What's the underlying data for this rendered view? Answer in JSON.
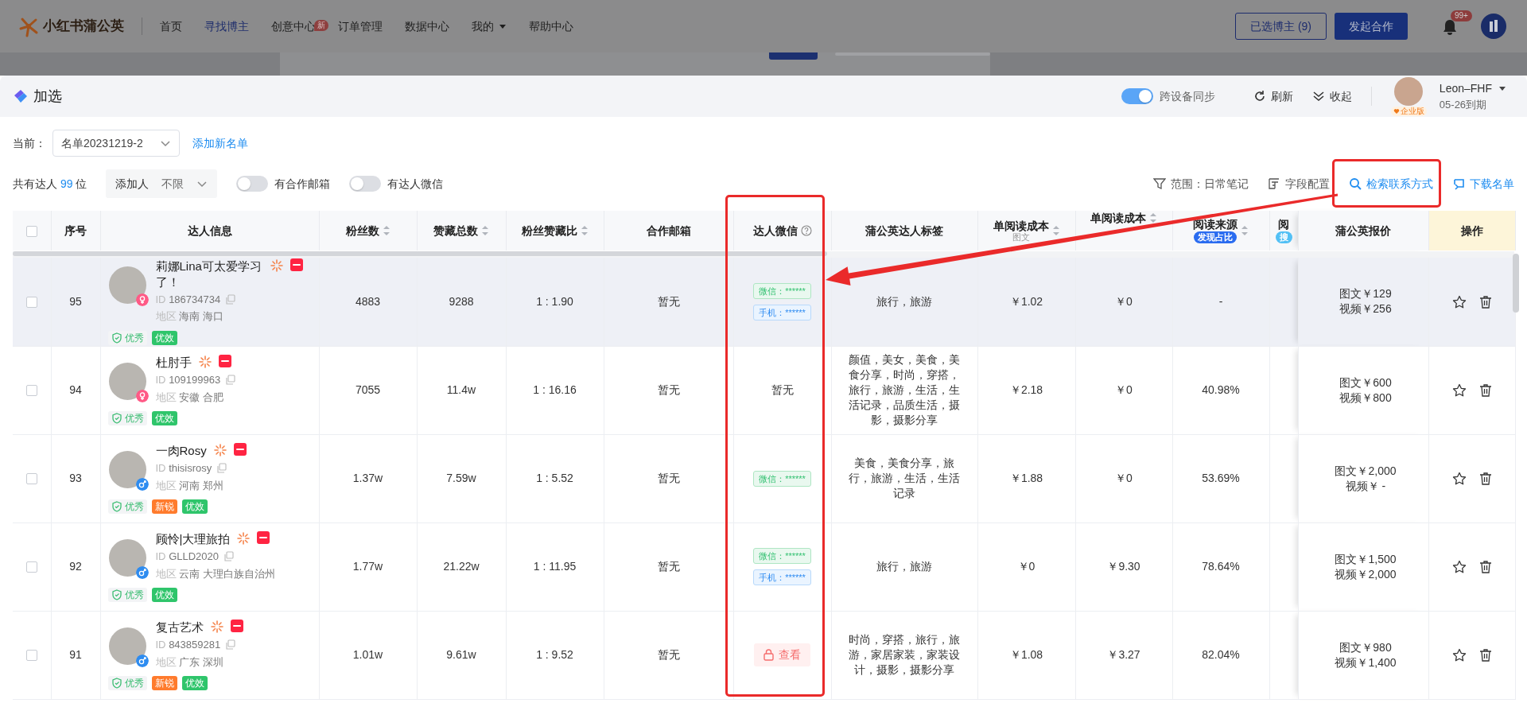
{
  "app_nav": {
    "logo": "小红书蒲公英",
    "items": [
      {
        "label": "首页",
        "selected": false
      },
      {
        "label": "寻找博主",
        "selected": true
      },
      {
        "label": "创意中心",
        "selected": false,
        "badge": "新"
      },
      {
        "label": "订单管理",
        "selected": false
      },
      {
        "label": "数据中心",
        "selected": false
      },
      {
        "label": "我的",
        "selected": false,
        "dropdown": true
      },
      {
        "label": "帮助中心",
        "selected": false
      }
    ],
    "selected_button": "已选博主 (9)",
    "primary_button": "发起合作",
    "notification_badge": "99+"
  },
  "panel": {
    "title": "加选",
    "sync": {
      "label": "跨设备同步",
      "on": true
    },
    "refresh": "刷新",
    "collapse": "收起",
    "user": {
      "name": "Leon–FHF",
      "expiry": "05-26到期",
      "badge": "企业版"
    }
  },
  "list_bar": {
    "label": "当前：",
    "selected_list": "名单20231219-2",
    "add_link": "添加新名单"
  },
  "filter_bar": {
    "total_prefix": "共有达人",
    "total_count": "99",
    "total_suffix": "位",
    "adder": {
      "label": "添加人",
      "value": "不限"
    },
    "toggles": [
      {
        "label": "有合作邮箱",
        "on": false
      },
      {
        "label": "有达人微信",
        "on": false
      }
    ],
    "actions": [
      {
        "label": "范围：日常笔记",
        "kind": "filter",
        "highlighted": false
      },
      {
        "label": "字段配置",
        "kind": "fields",
        "highlighted": false
      },
      {
        "label": "检索联系方式",
        "kind": "search",
        "highlighted": true
      },
      {
        "label": "下载名单",
        "kind": "download",
        "highlighted": true
      }
    ]
  },
  "table": {
    "columns": [
      {
        "kind": "checkbox",
        "checked": false
      },
      {
        "label": "序号"
      },
      {
        "label": "达人信息"
      },
      {
        "label": "粉丝数",
        "sortable": true
      },
      {
        "label": "赞藏总数",
        "sortable": true
      },
      {
        "label": "粉丝赞藏比",
        "sortable": true
      },
      {
        "label": "合作邮箱"
      },
      {
        "label": "达人微信",
        "help": true
      },
      {
        "label": "蒲公英达人标签"
      },
      {
        "label": "单阅读成本",
        "sub": "图文",
        "sortable": true
      },
      {
        "label": "单阅读成本",
        "sortable": true
      },
      {
        "label": "阅读来源",
        "badge": "发现占比",
        "sortable": true
      },
      {
        "label": "阅",
        "badge": "搜"
      },
      {
        "label": "蒲公英报价"
      },
      {
        "label": "操作"
      }
    ],
    "rows": [
      {
        "checked": false,
        "highlighted": true,
        "index": "95",
        "name": "莉娜Lina可太爱学习了！",
        "female": true,
        "id_label": "ID",
        "id": "186734734",
        "region_label": "地区",
        "region": "海南 海口",
        "tags": [
          {
            "label": "优秀",
            "kind": "excellent"
          },
          {
            "label": "优效",
            "kind": "effective"
          }
        ],
        "fans": "4883",
        "likes": "9288",
        "ratio": "1 : 1.90",
        "email": "暂无",
        "contact": {
          "kind": "masked",
          "items": [
            {
              "label": "微信：******",
              "kind": "wechat"
            },
            {
              "label": "手机：******",
              "kind": "phone"
            }
          ]
        },
        "topics": "旅行，旅游",
        "cost_image": "￥1.02",
        "cost_video": "￥0",
        "discover_share": "-",
        "price": [
          "图文￥129",
          "视频￥256"
        ]
      },
      {
        "checked": false,
        "highlighted": false,
        "index": "94",
        "name": "杜肘手",
        "female": true,
        "id_label": "ID",
        "id": "109199963",
        "region_label": "地区",
        "region": "安徽 合肥",
        "tags": [
          {
            "label": "优秀",
            "kind": "excellent"
          },
          {
            "label": "优效",
            "kind": "effective"
          }
        ],
        "fans": "7055",
        "likes": "11.4w",
        "ratio": "1 : 16.16",
        "email": "暂无",
        "contact": {
          "kind": "none",
          "label": "暂无"
        },
        "topics": "颜值，美女，美食，美食分享，时尚，穿搭，旅行，旅游，生活，生活记录，品质生活，摄影，摄影分享",
        "cost_image": "￥2.18",
        "cost_video": "￥0",
        "discover_share": "40.98%",
        "price": [
          "图文￥600",
          "视频￥800"
        ]
      },
      {
        "checked": false,
        "highlighted": false,
        "index": "93",
        "name": "一肉Rosy",
        "female": false,
        "id_label": "ID",
        "id": "thisisrosy",
        "region_label": "地区",
        "region": "河南 郑州",
        "tags": [
          {
            "label": "优秀",
            "kind": "excellent"
          },
          {
            "label": "新锐",
            "kind": "new"
          },
          {
            "label": "优效",
            "kind": "effective"
          }
        ],
        "fans": "1.37w",
        "likes": "7.59w",
        "ratio": "1 : 5.52",
        "email": "暂无",
        "contact": {
          "kind": "masked",
          "items": [
            {
              "label": "微信：******",
              "kind": "wechat"
            }
          ]
        },
        "topics": "美食，美食分享，旅行，旅游，生活，生活记录",
        "cost_image": "￥1.88",
        "cost_video": "￥0",
        "discover_share": "53.69%",
        "price": [
          "图文￥2,000",
          "视频￥ -"
        ]
      },
      {
        "checked": false,
        "highlighted": false,
        "index": "92",
        "name": "顾怜|大理旅拍",
        "female": false,
        "id_label": "ID",
        "id": "GLLD2020",
        "region_label": "地区",
        "region": "云南 大理白族自治州",
        "tags": [
          {
            "label": "优秀",
            "kind": "excellent"
          },
          {
            "label": "优效",
            "kind": "effective"
          }
        ],
        "fans": "1.77w",
        "likes": "21.22w",
        "ratio": "1 : 11.95",
        "email": "暂无",
        "contact": {
          "kind": "masked",
          "items": [
            {
              "label": "微信：******",
              "kind": "wechat"
            },
            {
              "label": "手机：******",
              "kind": "phone"
            }
          ]
        },
        "topics": "旅行，旅游",
        "cost_image": "￥0",
        "cost_video": "￥9.30",
        "discover_share": "78.64%",
        "price": [
          "图文￥1,500",
          "视频￥2,000"
        ]
      },
      {
        "checked": false,
        "highlighted": false,
        "index": "91",
        "name": "复古艺术",
        "female": false,
        "id_label": "ID",
        "id": "843859281",
        "region_label": "地区",
        "region": "广东 深圳",
        "tags": [
          {
            "label": "优秀",
            "kind": "excellent"
          },
          {
            "label": "新锐",
            "kind": "new"
          },
          {
            "label": "优效",
            "kind": "effective"
          }
        ],
        "fans": "1.01w",
        "likes": "9.61w",
        "ratio": "1 : 9.52",
        "email": "暂无",
        "contact": {
          "kind": "locked",
          "label": "查看"
        },
        "topics": "时尚，穿搭，旅行，旅游，家居家装，家装设计，摄影，摄影分享",
        "cost_image": "￥1.08",
        "cost_video": "￥3.27",
        "discover_share": "82.04%",
        "price": [
          "图文￥980",
          "视频￥1,400"
        ]
      }
    ]
  }
}
